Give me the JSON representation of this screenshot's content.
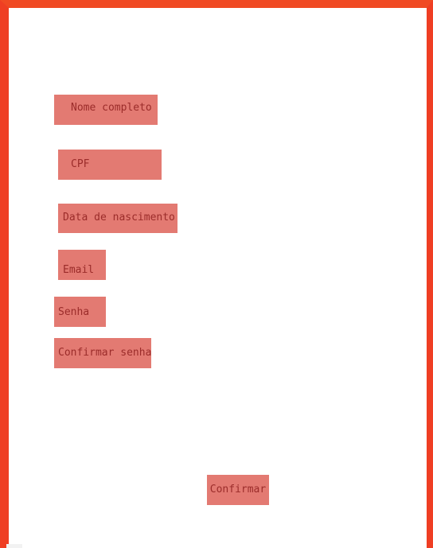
{
  "form": {
    "fields": [
      {
        "label": "Nome completo"
      },
      {
        "label": "CPF"
      },
      {
        "label": "Data de nascimento"
      },
      {
        "label": "Email"
      },
      {
        "label": "Senha"
      },
      {
        "label": "Confirmar senha"
      }
    ],
    "submit_label": "Confirmar"
  },
  "colors": {
    "frame_border": "#ef3e23",
    "field_background": "#e37a72",
    "field_text": "#9b2c2a",
    "page_background": "#ffffff"
  }
}
